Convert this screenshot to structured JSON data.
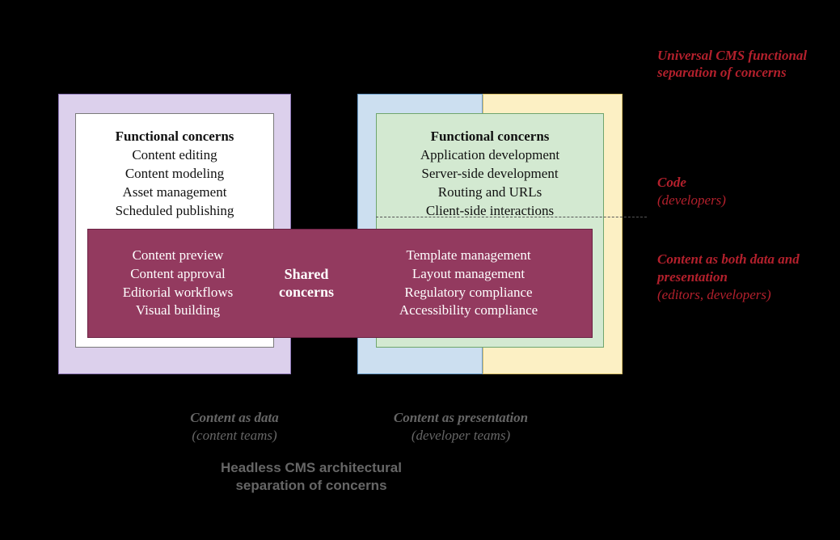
{
  "title_top": "Universal CMS functional separation of concerns",
  "side_code": {
    "t1": "Code",
    "t2": "(developers)"
  },
  "side_content": {
    "t1": "Content as both data and presentation",
    "t2": "(editors, developers)"
  },
  "func_left": {
    "head": "Functional concerns",
    "i1": "Content editing",
    "i2": "Content modeling",
    "i3": "Asset management",
    "i4": "Scheduled publishing"
  },
  "func_right": {
    "head": "Functional concerns",
    "i1": "Application development",
    "i2": "Server-side development",
    "i3": "Routing and URLs",
    "i4": "Client-side interactions"
  },
  "shared": {
    "mid": "Shared concerns",
    "l1": "Content preview",
    "l2": "Content approval",
    "l3": "Editorial workflows",
    "l4": "Visual building",
    "r1": "Template management",
    "r2": "Layout management",
    "r3": "Regulatory compliance",
    "r4": "Accessibility compliance"
  },
  "bottom_left": {
    "t1": "Content as data",
    "t2": "(content teams)"
  },
  "bottom_right": {
    "t1": "Content as presentation",
    "t2": "(developer teams)"
  },
  "bottom_title": "Headless CMS architectural separation of concerns"
}
